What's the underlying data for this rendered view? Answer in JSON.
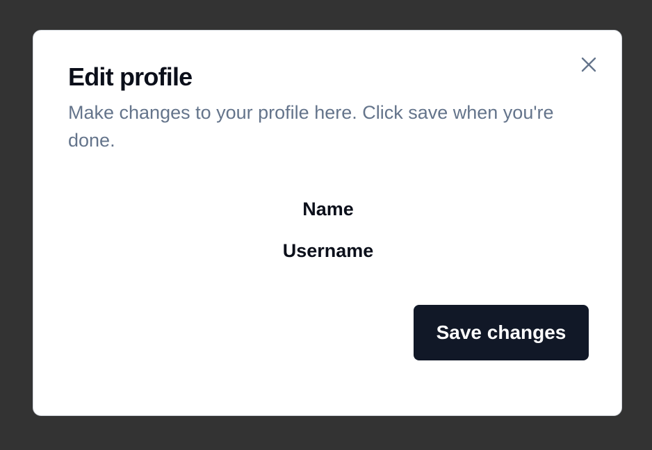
{
  "dialog": {
    "title": "Edit profile",
    "description": "Make changes to your profile here. Click save when you're done.",
    "close_icon": "close-icon",
    "fields": {
      "name_label": "Name",
      "username_label": "Username"
    },
    "save_label": "Save changes"
  },
  "colors": {
    "backdrop": "#333333",
    "dialog_bg": "#ffffff",
    "title": "#0b0f1a",
    "description": "#64748b",
    "button_bg": "#111827",
    "button_text": "#ffffff",
    "close_icon": "#64748b"
  }
}
